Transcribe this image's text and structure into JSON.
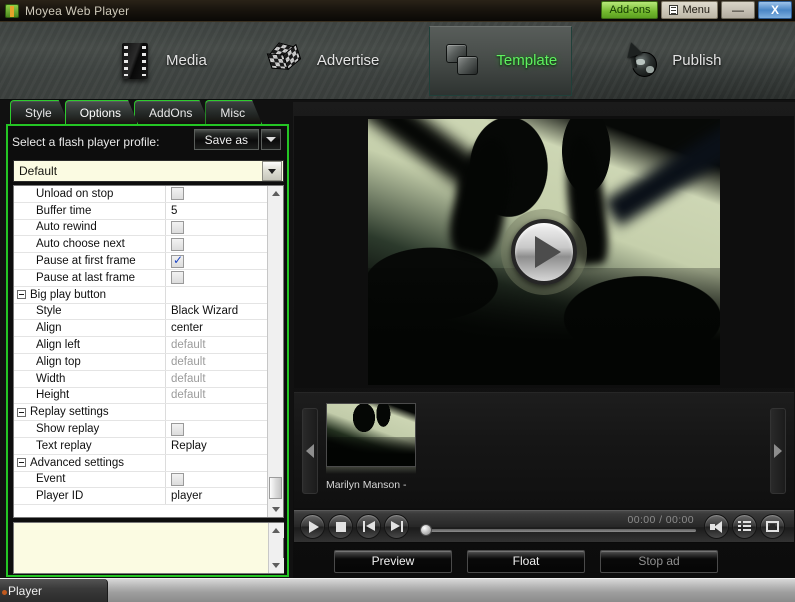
{
  "window": {
    "title": "Moyea Web Player",
    "app_icon": "package-icon",
    "controls": {
      "addons": "Add-ons",
      "menu": "Menu",
      "minimize": "—",
      "close": "X"
    }
  },
  "nav": {
    "items": [
      {
        "label": "Media",
        "icon": "film-strip-icon",
        "active": false
      },
      {
        "label": "Advertise",
        "icon": "checker-cube-icon",
        "active": false
      },
      {
        "label": "Template",
        "icon": "stacked-squares-icon",
        "active": true
      },
      {
        "label": "Publish",
        "icon": "globe-arrow-icon",
        "active": false
      }
    ]
  },
  "tabs": [
    {
      "label": "Style",
      "active": false
    },
    {
      "label": "Options",
      "active": true
    },
    {
      "label": "AddOns",
      "active": false
    },
    {
      "label": "Misc",
      "active": false
    }
  ],
  "panel": {
    "profile_label": "Select a flash player profile:",
    "save_as": "Save as",
    "profile_value": "Default",
    "rows": [
      {
        "name": "Unload on stop",
        "type": "checkbox",
        "value": "",
        "checked": false,
        "indent": "child"
      },
      {
        "name": "Buffer time",
        "type": "text",
        "value": "5",
        "indent": "child"
      },
      {
        "name": "Auto rewind",
        "type": "checkbox",
        "value": "",
        "checked": false,
        "indent": "child"
      },
      {
        "name": "Auto choose next",
        "type": "checkbox",
        "value": "",
        "checked": false,
        "indent": "child"
      },
      {
        "name": "Pause at first frame",
        "type": "checkbox",
        "value": "",
        "checked": true,
        "indent": "child"
      },
      {
        "name": "Pause at last frame",
        "type": "checkbox",
        "value": "",
        "checked": false,
        "indent": "child"
      },
      {
        "name": "Big play button",
        "type": "category",
        "value": "",
        "indent": "cat"
      },
      {
        "name": "Style",
        "type": "text",
        "value": "Black Wizard",
        "indent": "child"
      },
      {
        "name": "Align",
        "type": "text",
        "value": "center",
        "indent": "child"
      },
      {
        "name": "Align left",
        "type": "dim",
        "value": "default",
        "indent": "child"
      },
      {
        "name": "Align top",
        "type": "dim",
        "value": "default",
        "indent": "child"
      },
      {
        "name": "Width",
        "type": "dim",
        "value": "default",
        "indent": "child"
      },
      {
        "name": "Height",
        "type": "dim",
        "value": "default",
        "indent": "child"
      },
      {
        "name": "Replay settings",
        "type": "category",
        "value": "",
        "indent": "cat"
      },
      {
        "name": "Show replay",
        "type": "checkbox",
        "value": "",
        "checked": false,
        "indent": "child"
      },
      {
        "name": "Text replay",
        "type": "text",
        "value": "Replay",
        "indent": "child"
      },
      {
        "name": "Advanced settings",
        "type": "category",
        "value": "",
        "indent": "cat"
      },
      {
        "name": "Event",
        "type": "checkbox",
        "value": "",
        "checked": false,
        "indent": "child"
      },
      {
        "name": "Player ID",
        "type": "text",
        "value": "player",
        "indent": "child"
      }
    ],
    "description_text": ""
  },
  "preview": {
    "big_play_icon": "play-circle-icon",
    "playlist": {
      "prev_icon": "chevron-left-icon",
      "next_icon": "chevron-right-icon",
      "items": [
        {
          "title": "Marilyn Manson -"
        }
      ]
    },
    "controls": {
      "play": "play-icon",
      "stop": "stop-icon",
      "previous": "previous-track-icon",
      "next": "next-track-icon",
      "volume": "volume-icon",
      "playlist_toggle": "playlist-icon",
      "fullscreen": "fullscreen-icon",
      "timecode": "00:00 / 00:00"
    },
    "actions": [
      {
        "label": "Preview",
        "disabled": false
      },
      {
        "label": "Float",
        "disabled": false
      },
      {
        "label": "Stop ad",
        "disabled": true
      }
    ]
  },
  "taskbar": {
    "items": [
      {
        "label": "Player"
      }
    ]
  },
  "colors": {
    "accent_green": "#24c524",
    "active_nav_text": "#5ff25f",
    "addons_green": "#74b92f",
    "close_blue": "#4a86c6",
    "field_cream": "#fbfbe2"
  }
}
